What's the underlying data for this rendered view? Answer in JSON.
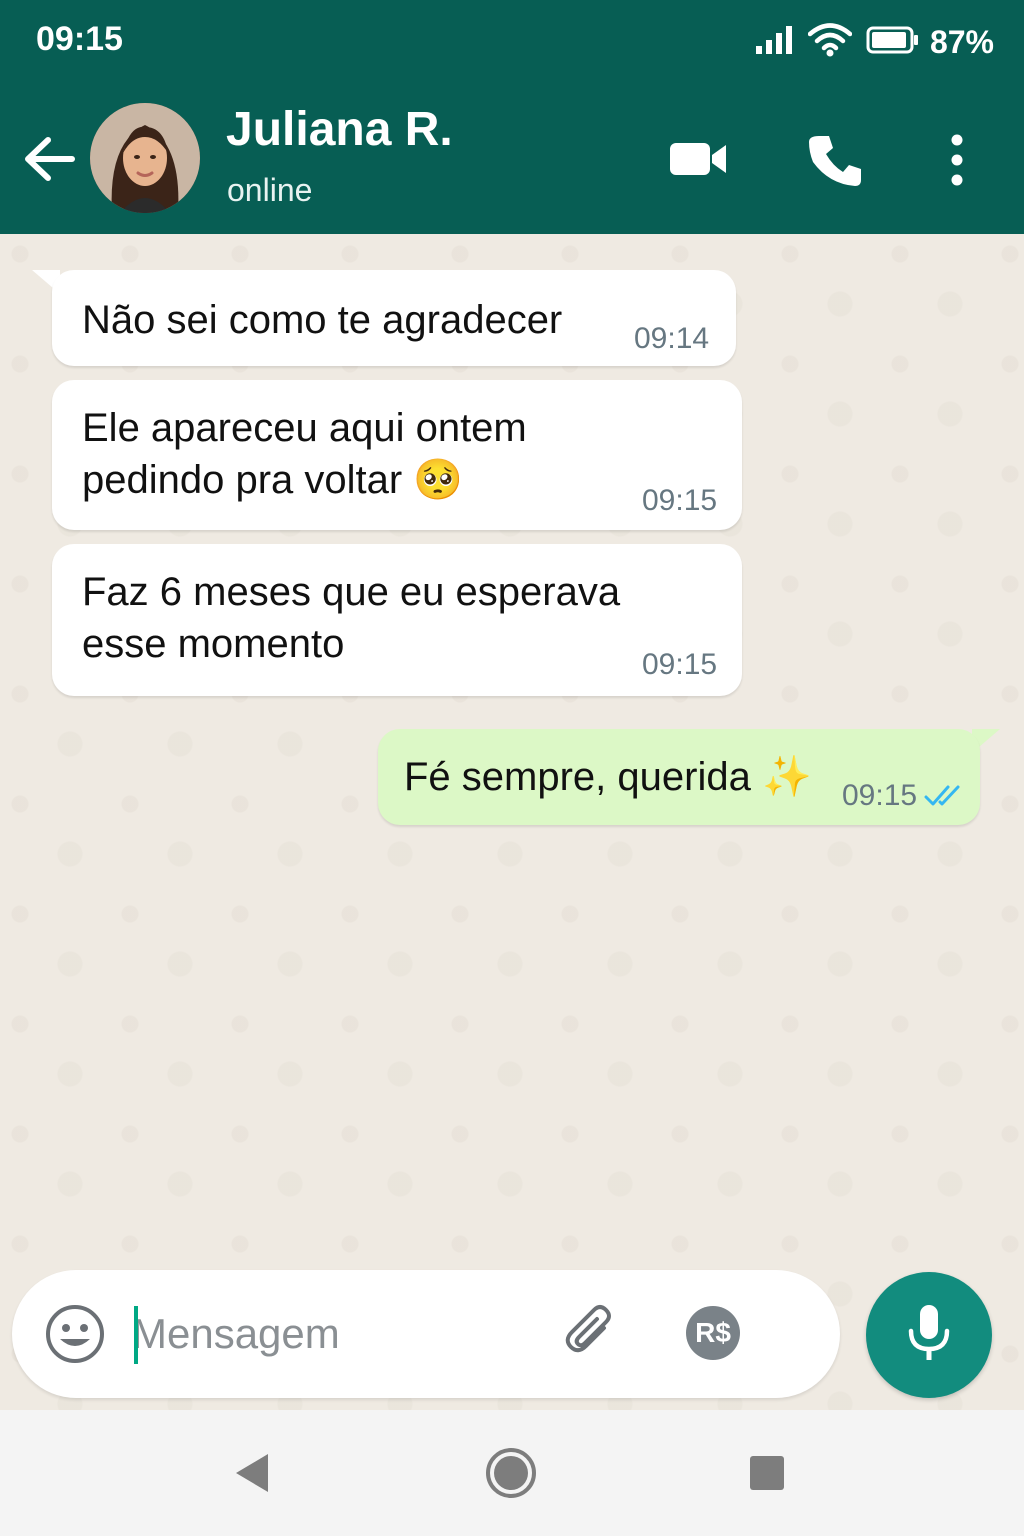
{
  "status_bar": {
    "time": "09:15",
    "battery": "87%",
    "icons": [
      "signal-icon",
      "wifi-icon",
      "battery-icon"
    ]
  },
  "header": {
    "contact_name": "Juliana R.",
    "contact_status": "online",
    "icons": [
      "back-arrow-icon",
      "video-call-icon",
      "phone-icon",
      "more-vert-icon"
    ]
  },
  "messages": [
    {
      "direction": "in",
      "text": "Não sei como te agradecer",
      "time": "09:14"
    },
    {
      "direction": "in",
      "text": "Ele apareceu aqui ontem\npedindo pra voltar 🥺",
      "time": "09:15"
    },
    {
      "direction": "in",
      "text": "Faz 6 meses que eu esperava\nesse momento",
      "time": "09:15"
    },
    {
      "direction": "out",
      "text": "Fé sempre, querida ✨",
      "time": "09:15",
      "status": "read"
    }
  ],
  "composer": {
    "placeholder": "Mensagem",
    "value": "",
    "pay_label": "R$"
  },
  "colors": {
    "header_bg": "#075e54",
    "incoming_bubble": "#ffffff",
    "outgoing_bubble": "#dcf8c6",
    "mic_button": "#128c7e",
    "read_ticks": "#34b7f1"
  }
}
